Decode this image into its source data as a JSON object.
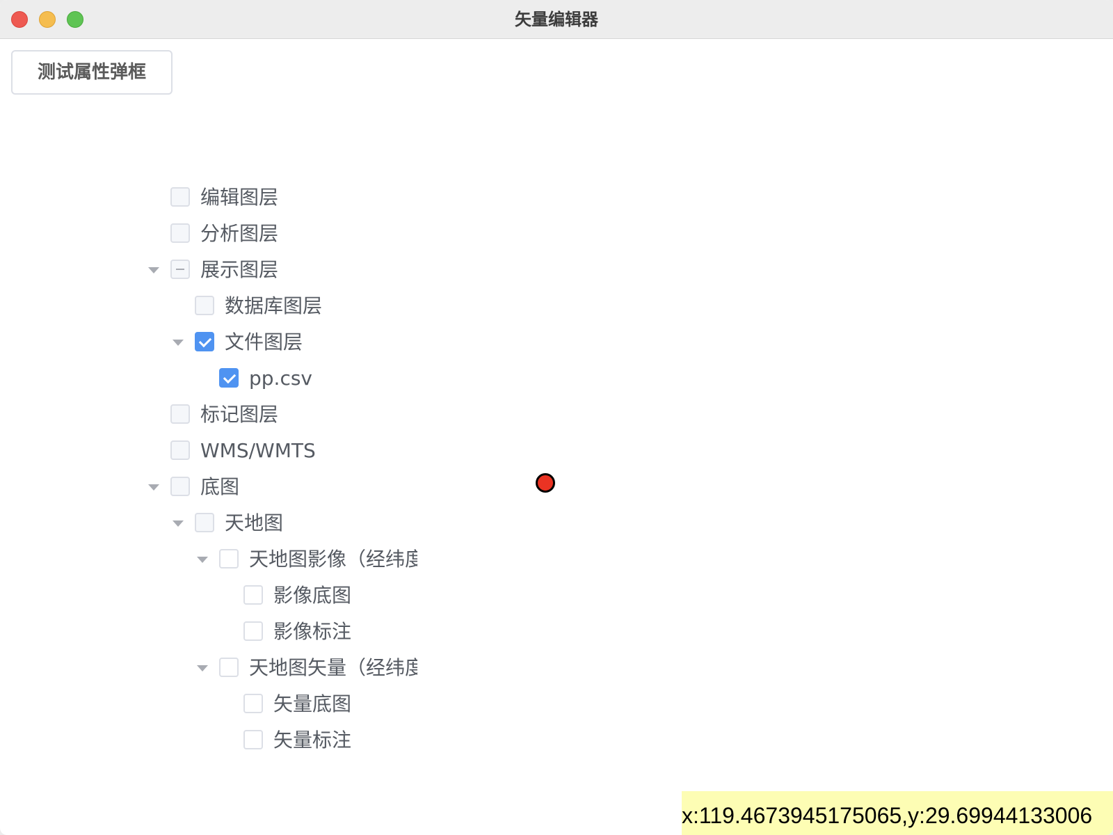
{
  "window": {
    "title": "矢量编辑器"
  },
  "toolbar": {
    "test_button_label": "测试属性弹框"
  },
  "layer_tree": [
    {
      "label": "编辑图层",
      "level": 0,
      "expandable": false,
      "state": "unchecked"
    },
    {
      "label": "分析图层",
      "level": 0,
      "expandable": false,
      "state": "unchecked"
    },
    {
      "label": "展示图层",
      "level": 0,
      "expandable": true,
      "state": "indeterminate"
    },
    {
      "label": "数据库图层",
      "level": 1,
      "expandable": false,
      "state": "unchecked"
    },
    {
      "label": "文件图层",
      "level": 1,
      "expandable": true,
      "state": "checked"
    },
    {
      "label": "pp.csv",
      "level": 2,
      "expandable": false,
      "state": "checked"
    },
    {
      "label": "标记图层",
      "level": 0,
      "expandable": false,
      "state": "unchecked"
    },
    {
      "label": "WMS/WMTS",
      "level": 0,
      "expandable": false,
      "state": "unchecked"
    },
    {
      "label": "底图",
      "level": 0,
      "expandable": true,
      "state": "unchecked"
    },
    {
      "label": "天地图",
      "level": 1,
      "expandable": true,
      "state": "unchecked"
    },
    {
      "label": "天地图影像（经纬度）",
      "level": 2,
      "expandable": true,
      "state": "unchecked"
    },
    {
      "label": "影像底图",
      "level": 3,
      "expandable": false,
      "state": "unchecked"
    },
    {
      "label": "影像标注",
      "level": 3,
      "expandable": false,
      "state": "unchecked"
    },
    {
      "label": "天地图矢量（经纬度）",
      "level": 2,
      "expandable": true,
      "state": "unchecked"
    },
    {
      "label": "矢量底图",
      "level": 3,
      "expandable": false,
      "state": "unchecked"
    },
    {
      "label": "矢量标注",
      "level": 3,
      "expandable": false,
      "state": "unchecked"
    }
  ],
  "status": {
    "coordinates": "x:119.4673945175065,y:29.69944133006"
  },
  "colors": {
    "checkbox_checked": "#4f93f1",
    "marker": "#ea3323",
    "coordinate_readout_bg": "#fdfdb4"
  }
}
